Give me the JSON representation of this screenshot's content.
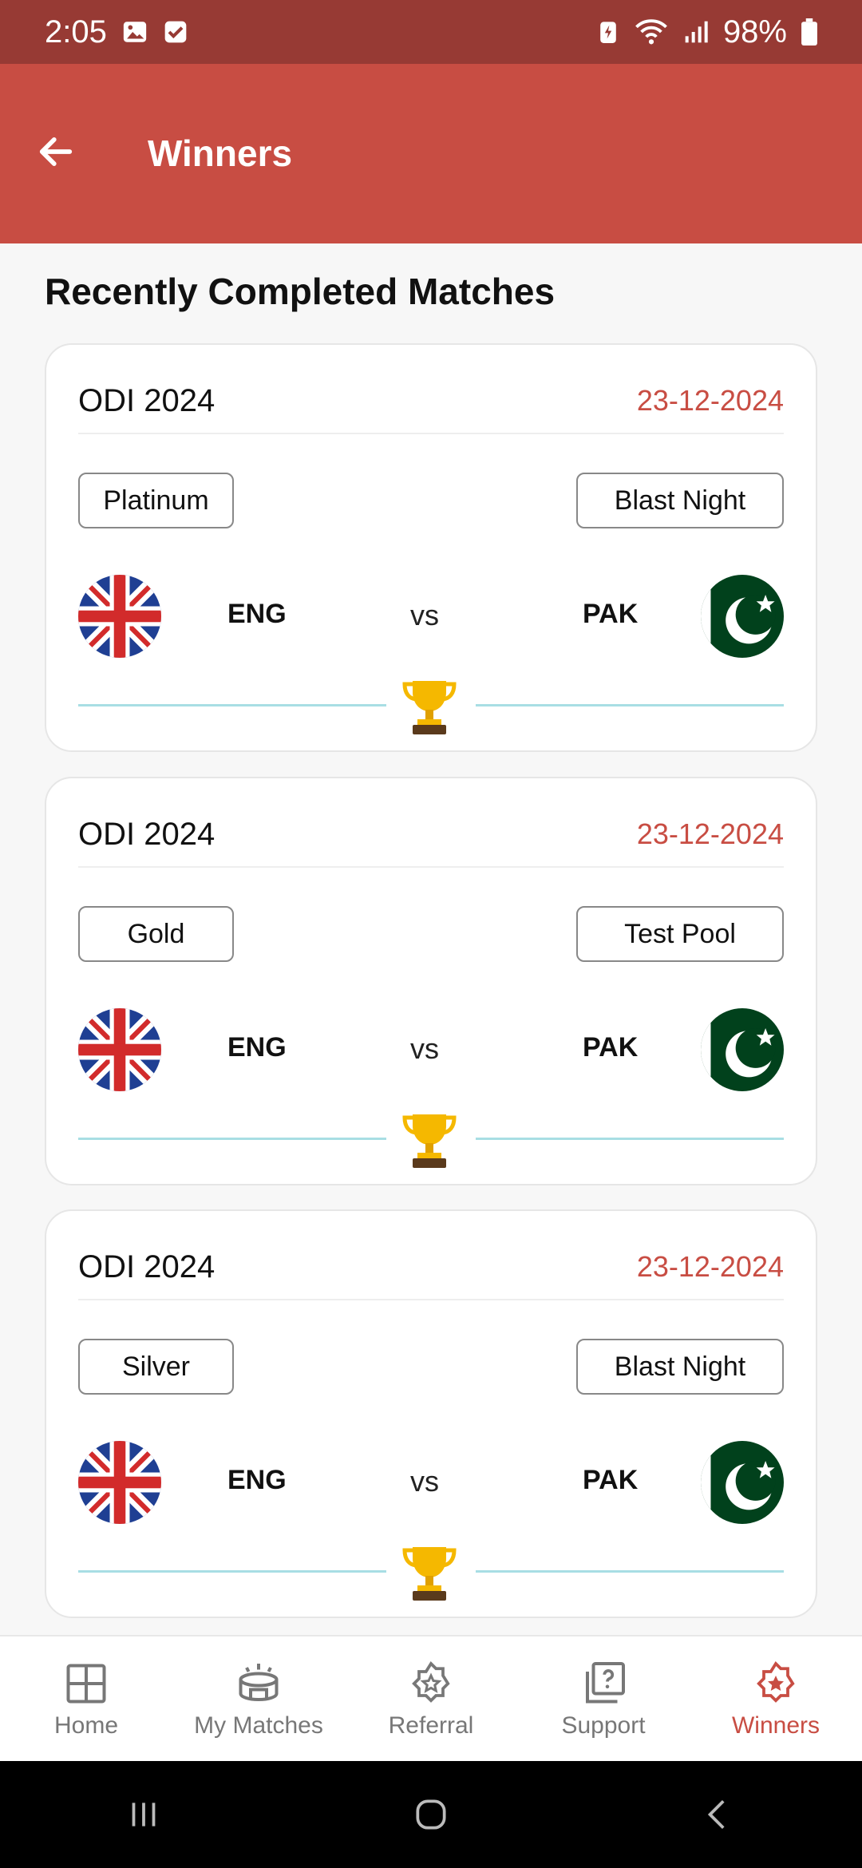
{
  "status_bar": {
    "time": "2:05",
    "left_icons": [
      "image-icon",
      "checkbox-icon"
    ],
    "right_icons": [
      "battery-saver-icon",
      "wifi-icon",
      "signal-icon"
    ],
    "battery": "98%"
  },
  "app_bar": {
    "back_icon": "arrow-left-icon",
    "title": "Winners"
  },
  "section": {
    "title": "Recently Completed Matches"
  },
  "matches": [
    {
      "series": "ODI 2024",
      "date": "23-12-2024",
      "tier": "Platinum",
      "pool": "Blast Night",
      "team1": "ENG",
      "vs": "vs",
      "team2": "PAK"
    },
    {
      "series": "ODI 2024",
      "date": "23-12-2024",
      "tier": "Gold",
      "pool": "Test Pool",
      "team1": "ENG",
      "vs": "vs",
      "team2": "PAK"
    },
    {
      "series": "ODI 2024",
      "date": "23-12-2024",
      "tier": "Silver",
      "pool": "Blast Night",
      "team1": "ENG",
      "vs": "vs",
      "team2": "PAK"
    }
  ],
  "bottom_nav": [
    {
      "label": "Home",
      "icon": "home-grid-icon",
      "active": false
    },
    {
      "label": "My Matches",
      "icon": "stadium-icon",
      "active": false
    },
    {
      "label": "Referral",
      "icon": "star-badge-icon",
      "active": false
    },
    {
      "label": "Support",
      "icon": "help-copy-icon",
      "active": false
    },
    {
      "label": "Winners",
      "icon": "star-badge-icon",
      "active": true
    }
  ],
  "colors": {
    "status_bar": "#973a34",
    "app_bar": "#c84d43",
    "accent": "#c84d43",
    "divider": "#a8dee4",
    "pak_green": "#01411c"
  }
}
